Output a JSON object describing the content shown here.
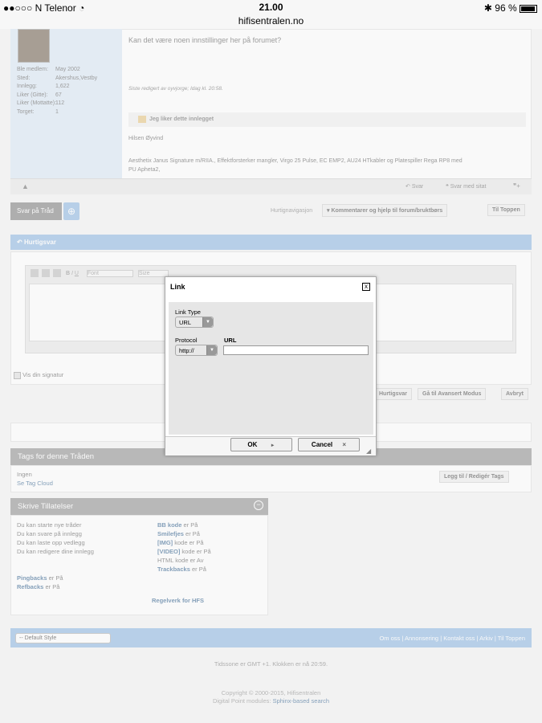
{
  "status_bar": {
    "carrier": "●●○○○ N Telenor",
    "time": "21.00",
    "url": "hifisentralen.no",
    "battery": "96 %"
  },
  "user": {
    "fields": [
      {
        "label": "Ble medlem:",
        "value": "May 2002"
      },
      {
        "label": "Sted:",
        "value": "Akershus,Vestby"
      },
      {
        "label": "Innlegg:",
        "value": "1,622"
      },
      {
        "label": "Liker (Gitte):",
        "value": "67"
      },
      {
        "label": "Liker (Mottatte):",
        "value": "112"
      },
      {
        "label": "Torget:",
        "value": "1"
      }
    ]
  },
  "post": {
    "text": "Kan det være noen innstillinger her på forumet?",
    "edit_note": "Siste redigert av oyvjorge; Idag kl. 20:58.",
    "like_label": "Jeg liker dette innlegget",
    "greeting": "Hilsen Øyvind",
    "signature_line1": "Aesthetix Janus Signature m/RIIA., Effektforsterker mangler, Virgo 25 Pulse, EC EMP2, AU24 HTkabler og Platespiller Rega RP8 med",
    "signature_line2": "PU Apheta2,",
    "reply_label": "Svar",
    "quote_label": "Svar med sitat"
  },
  "nav": {
    "reply_thread": "Svar på Tråd",
    "quicknav": "Hurtignavigasjon",
    "forum_link": "Kommentarer og hjelp til forum/bruktbørs",
    "to_top": "Til Toppen"
  },
  "quickreply": {
    "title": "Hurtigsvar",
    "font_placeholder": "Font",
    "size_placeholder": "Size",
    "show_signature": "Vis din signatur",
    "btn_quick": "Hurtigsvar",
    "btn_advanced": "Gå til Avansert Modus",
    "btn_cancel": "Avbryt"
  },
  "tags": {
    "title": "Tags for denne Tråden",
    "none": "Ingen",
    "cloud": "Se Tag Cloud",
    "edit": "Legg til / Redigér Tags"
  },
  "permissions": {
    "title": "Skrive Tillatelser",
    "left": [
      "Du kan starte nye tråder",
      "Du kan svare på innlegg",
      "Du kan laste opp vedlegg",
      "Du kan redigere dine innlegg"
    ],
    "right": [
      {
        "b": "BB kode",
        "t": " er På"
      },
      {
        "b": "Smilefjes",
        "t": " er På"
      },
      {
        "b": "[IMG]",
        "t": " kode er På"
      },
      {
        "b": "[VIDEO]",
        "t": " kode er På"
      },
      {
        "b": "",
        "t": "HTML kode er Av"
      },
      {
        "b": "Trackbacks",
        "t": " er På"
      }
    ],
    "pingbacks": "Pingbacks",
    "pingbacks_state": " er På",
    "refbacks": "Refbacks",
    "refbacks_state": " er På",
    "rules": "Regelverk for HFS"
  },
  "footer": {
    "style_select": "-- Default Style",
    "links": [
      "Om oss",
      "Annonsering",
      "Kontakt oss",
      "Arkiv",
      "Til Toppen"
    ],
    "timezone_prefix": "Tidssone er GMT +1. Klokken er nå",
    "time": "20:59.",
    "copyright": "Copyright © 2000-2015, Hifisentralen",
    "dp_prefix": "Digital Point modules:",
    "dp_link": "Sphinx-based search"
  },
  "modal": {
    "title": "Link",
    "close": "x",
    "link_type_label": "Link Type",
    "link_type_value": "URL",
    "protocol_label": "Protocol",
    "protocol_value": "http://",
    "url_label": "URL",
    "url_value": "",
    "ok": "OK",
    "cancel": "Cancel"
  }
}
